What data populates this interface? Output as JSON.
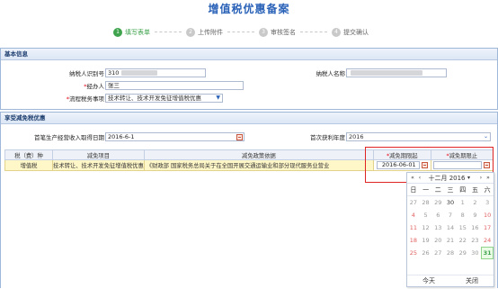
{
  "page": {
    "title": "增值税优惠备案"
  },
  "steps": [
    {
      "num": "1",
      "label": "填写表单",
      "active": true
    },
    {
      "num": "2",
      "label": "上传附件",
      "active": false
    },
    {
      "num": "3",
      "label": "审核签名",
      "active": false
    },
    {
      "num": "4",
      "label": "提交确认",
      "active": false
    }
  ],
  "basic_info": {
    "section_title": "基本信息",
    "taxpayer_id": {
      "label": "纳税人识别号",
      "value": "310"
    },
    "taxpayer_name": {
      "label": "纳税人名称",
      "value": ""
    },
    "handler": {
      "label": "经办人",
      "value": "张三"
    },
    "process_item": {
      "label": "流程税务事项",
      "value": "技术转让、技术开发免征增值税优惠"
    }
  },
  "preferential": {
    "section_title": "享受减免税优惠",
    "first_income_date": {
      "label": "首笔生产经营收入取得日期",
      "value": "2016-6-1"
    },
    "first_profit_year": {
      "label": "首次获利年度",
      "value": "2016"
    },
    "table": {
      "headers": [
        "税（费）种",
        "减免项目",
        "减免政策依据",
        "减免期限起",
        "减免期限止"
      ],
      "rows": [
        [
          "增值税",
          "技术转让、技术开发免征增值税优惠",
          "《财政部 国家税务总局关于在全国开展交通运输业和部分现代服务业营业",
          "2016-06-01",
          ""
        ]
      ]
    }
  },
  "calendar": {
    "month_label": "十二月 2016",
    "nav": {
      "prev_year": "«",
      "prev_month": "‹",
      "month_menu": "▾",
      "next_month": "›",
      "next_year": "»"
    },
    "weekdays": [
      "日",
      "一",
      "二",
      "三",
      "四",
      "五",
      "六"
    ],
    "days": [
      [
        "27",
        "28",
        "29",
        "30",
        "1",
        "2",
        "3"
      ],
      [
        "4",
        "5",
        "6",
        "7",
        "8",
        "9",
        "10"
      ],
      [
        "11",
        "12",
        "13",
        "14",
        "15",
        "16",
        "17"
      ],
      [
        "18",
        "19",
        "20",
        "21",
        "22",
        "23",
        "24"
      ],
      [
        "25",
        "26",
        "27",
        "28",
        "29",
        "30",
        "31"
      ]
    ],
    "today_button": "今天",
    "close_button": "关闭"
  },
  "colors": {
    "accent": "#2a62b8",
    "active_step": "#3fa34d",
    "highlight_border": "#e02424",
    "row_highlight": "#fff7c8"
  }
}
